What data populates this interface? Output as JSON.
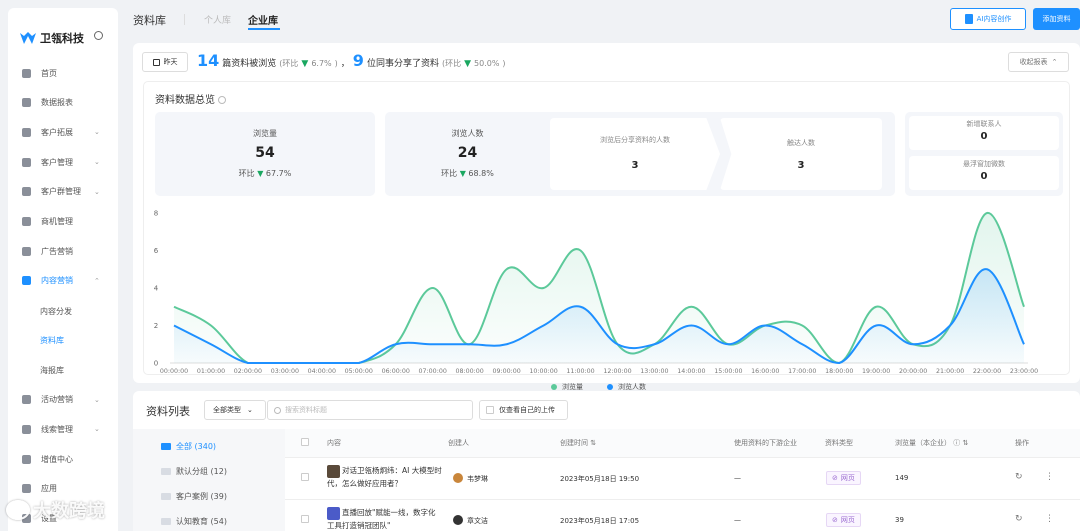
{
  "app": {
    "name": "卫瓴科技"
  },
  "sidebar": {
    "items": [
      {
        "label": "首页",
        "icon": "home-icon",
        "chevron": ""
      },
      {
        "label": "数据报表",
        "icon": "report-icon",
        "chevron": ""
      },
      {
        "label": "客户拓展",
        "icon": "expand-icon",
        "chevron": "⌄"
      },
      {
        "label": "客户管理",
        "icon": "customer-icon",
        "chevron": "⌄"
      },
      {
        "label": "客户群管理",
        "icon": "group-icon",
        "chevron": "⌄"
      },
      {
        "label": "商机管理",
        "icon": "opportunity-icon",
        "chevron": ""
      },
      {
        "label": "广告营销",
        "icon": "ad-icon",
        "chevron": ""
      },
      {
        "label": "内容营销",
        "icon": "content-icon",
        "chevron": "⌃"
      }
    ],
    "sub_items": [
      "内容分发",
      "资料库",
      "海报库"
    ],
    "items_after": [
      {
        "label": "活动营销",
        "icon": "event-icon",
        "chevron": "⌄"
      },
      {
        "label": "线索管理",
        "icon": "lead-icon",
        "chevron": "⌄"
      },
      {
        "label": "增值中心",
        "icon": "value-icon",
        "chevron": ""
      },
      {
        "label": "应用",
        "icon": "app-icon",
        "chevron": ""
      },
      {
        "label": "设置",
        "icon": "settings-icon",
        "chevron": ""
      }
    ]
  },
  "watermark": {
    "text": "大数跨境"
  },
  "topbar": {
    "title": "资料库",
    "tab_personal": "个人库",
    "tab_enterprise": "企业库",
    "ai_button": "AI内容创作",
    "add_button": "添加资料"
  },
  "summary": {
    "date_button": "昨天",
    "viewed_count": "14",
    "viewed_text": "篇资料被浏览",
    "viewed_ratio_prefix": "(环比",
    "viewed_ratio": "6.7%",
    "ratio_suffix": ")",
    "comma": "，",
    "shared_count": "9",
    "shared_text": "位同事分享了资料",
    "shared_ratio_prefix": "(环比",
    "shared_ratio": "50.0%",
    "report_button": "收起报表"
  },
  "overview": {
    "title": "资料数据总览",
    "views_label": "浏览量",
    "views_value": "54",
    "views_ratio_prefix": "环比",
    "views_ratio": "67.7%",
    "viewers_label": "浏览人数",
    "viewers_value": "24",
    "viewers_ratio_prefix": "环比",
    "viewers_ratio": "68.8%",
    "funnel": [
      {
        "label": "浏览后分享资料的人数",
        "value": "3"
      },
      {
        "label": "触达人数",
        "value": "3"
      }
    ],
    "right": [
      {
        "label": "新增联系人",
        "value": "0"
      },
      {
        "label": "悬浮窗加微数",
        "value": "0"
      }
    ]
  },
  "chart_data": {
    "type": "line",
    "x": [
      "00:00:00",
      "01:00:00",
      "02:00:00",
      "03:00:00",
      "04:00:00",
      "05:00:00",
      "06:00:00",
      "07:00:00",
      "08:00:00",
      "09:00:00",
      "10:00:00",
      "11:00:00",
      "12:00:00",
      "13:00:00",
      "14:00:00",
      "15:00:00",
      "16:00:00",
      "17:00:00",
      "18:00:00",
      "19:00:00",
      "20:00:00",
      "21:00:00",
      "22:00:00",
      "23:00:00"
    ],
    "series": [
      {
        "name": "浏览量",
        "color": "#5cc99a",
        "values": [
          3,
          2,
          0,
          0,
          0,
          0,
          1,
          4,
          1,
          5,
          4,
          6,
          1,
          1,
          3,
          1,
          2,
          2,
          0,
          3,
          1,
          2,
          8,
          3
        ]
      },
      {
        "name": "浏览人数",
        "color": "#1e90ff",
        "values": [
          2,
          1,
          0,
          0,
          0,
          0,
          1,
          1,
          1,
          1,
          2,
          3,
          1,
          1,
          2,
          1,
          2,
          1,
          0,
          2,
          1,
          2,
          5,
          1
        ]
      }
    ],
    "ylim": [
      0,
      8
    ],
    "yticks": [
      "0",
      "2",
      "4",
      "6",
      "8"
    ],
    "grid": false,
    "legend": "bottom"
  },
  "list": {
    "title": "资料列表",
    "type_select": "全部类型",
    "search_placeholder": "搜索资料标题",
    "mine_only": "仅查看自己的上传",
    "folders": [
      "全部 (340)",
      "默认分组 (12)",
      "客户案例 (39)",
      "认知教育 (54)"
    ],
    "headers": [
      "内容",
      "创建人",
      "创建时间",
      "使用资料的下游企业",
      "资料类型",
      "浏览量（本企业）",
      "操作"
    ],
    "rows": [
      {
        "title": "对话卫瓴杨炯纬：AI 大模型时代，怎么做好应用者？",
        "creator": "韦梦琳",
        "time": "2023年05月18日 19:50",
        "downstream": "—",
        "type": "网页",
        "views": "149"
      },
      {
        "title": "直播回放\"赋能一线，数字化工具打造销冠团队\"",
        "creator": "章文洁",
        "time": "2023年05月18日 17:05",
        "downstream": "—",
        "type": "网页",
        "views": "39"
      }
    ]
  }
}
